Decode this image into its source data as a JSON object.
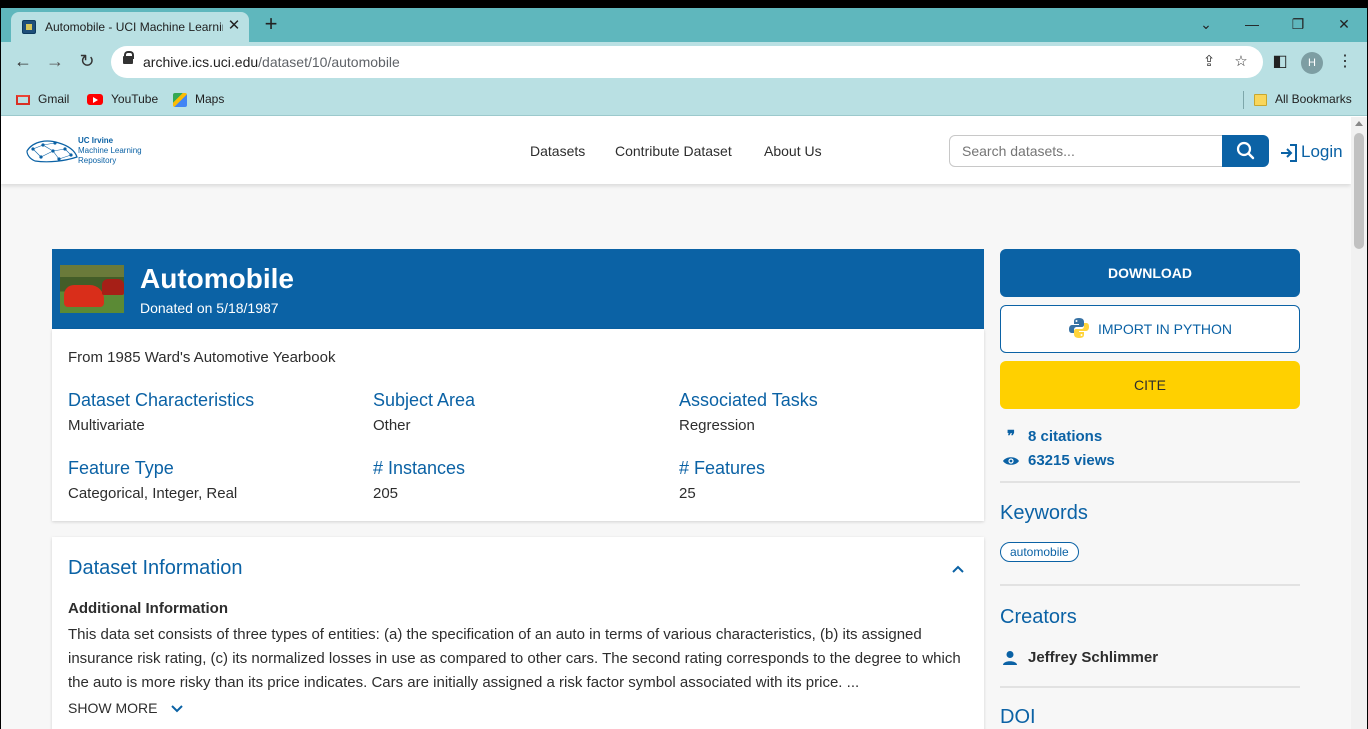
{
  "browser": {
    "tab_title": "Automobile - UCI Machine Learning Repository",
    "url_domain": "archive.ics.uci.edu",
    "url_path": "/dataset/10/automobile",
    "profile_initial": "H",
    "bookmarks": [
      "Gmail",
      "YouTube",
      "Maps"
    ],
    "all_bookmarks": "All Bookmarks"
  },
  "site": {
    "logo_lines": [
      "UC Irvine",
      "Machine Learning",
      "Repository"
    ],
    "nav": [
      "Datasets",
      "Contribute Dataset",
      "About Us"
    ],
    "search_placeholder": "Search datasets...",
    "login": "Login"
  },
  "dataset": {
    "title": "Automobile",
    "donated": "Donated on 5/18/1987",
    "summary": "From 1985 Ward's Automotive Yearbook",
    "characteristics": [
      {
        "label": "Dataset Characteristics",
        "value": "Multivariate"
      },
      {
        "label": "Subject Area",
        "value": "Other"
      },
      {
        "label": "Associated Tasks",
        "value": "Regression"
      },
      {
        "label": "Feature Type",
        "value": "Categorical, Integer, Real"
      },
      {
        "label": "# Instances",
        "value": "205"
      },
      {
        "label": "# Features",
        "value": "25"
      }
    ],
    "info_title": "Dataset Information",
    "info_subtitle": "Additional Information",
    "info_text": "This data set consists of three types of entities: (a) the specification of an auto in terms of various characteristics, (b) its assigned insurance risk rating, (c) its normalized losses in use as compared to other cars.  The second rating corresponds to the degree to which the auto is more risky than its price indicates. Cars are initially assigned a risk factor symbol associated with its price. ...",
    "show_more": "SHOW MORE"
  },
  "sidebar": {
    "download": "DOWNLOAD",
    "import_python": "IMPORT IN PYTHON",
    "cite": "CITE",
    "citations": "8 citations",
    "views": "63215 views",
    "keywords_title": "Keywords",
    "keyword": "automobile",
    "creators_title": "Creators",
    "creator": "Jeffrey Schlimmer",
    "doi_title": "DOI"
  },
  "colors": {
    "brand_blue": "#0b62a5",
    "cite_yellow": "#ffd000",
    "browser_frame": "#5fb7bd"
  }
}
